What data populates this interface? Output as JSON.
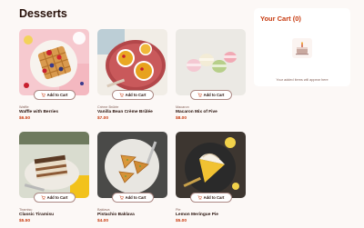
{
  "page": {
    "title": "Desserts"
  },
  "products": [
    {
      "category": "Waffle",
      "name": "Waffle with Berries",
      "price": "$6.50",
      "button_label": "Add to Cart",
      "image": "waffle-photo"
    },
    {
      "category": "Crème Brûlée",
      "name": "Vanilla Bean Crème Brûlée",
      "price": "$7.00",
      "button_label": "Add to Cart",
      "image": "creme-brulee-photo"
    },
    {
      "category": "Macaron",
      "name": "Macaron Mix of Five",
      "price": "$8.00",
      "button_label": "Add to Cart",
      "image": "macaron-photo"
    },
    {
      "category": "Tiramisu",
      "name": "Classic Tiramisu",
      "price": "$5.50",
      "button_label": "Add to Cart",
      "image": "tiramisu-photo"
    },
    {
      "category": "Baklava",
      "name": "Pistachio Baklava",
      "price": "$4.00",
      "button_label": "Add to Cart",
      "image": "baklava-photo"
    },
    {
      "category": "Pie",
      "name": "Lemon Meringue Pie",
      "price": "$5.00",
      "button_label": "Add to Cart",
      "image": "lemon-pie-photo"
    }
  ],
  "cart": {
    "title": "Your Cart (0)",
    "empty_message": "Your added items will appear here",
    "icon": "cake-illustration"
  },
  "colors": {
    "accent": "#c73a0f",
    "text": "#260f08",
    "muted": "#87635a",
    "background": "#fcf8f6"
  }
}
